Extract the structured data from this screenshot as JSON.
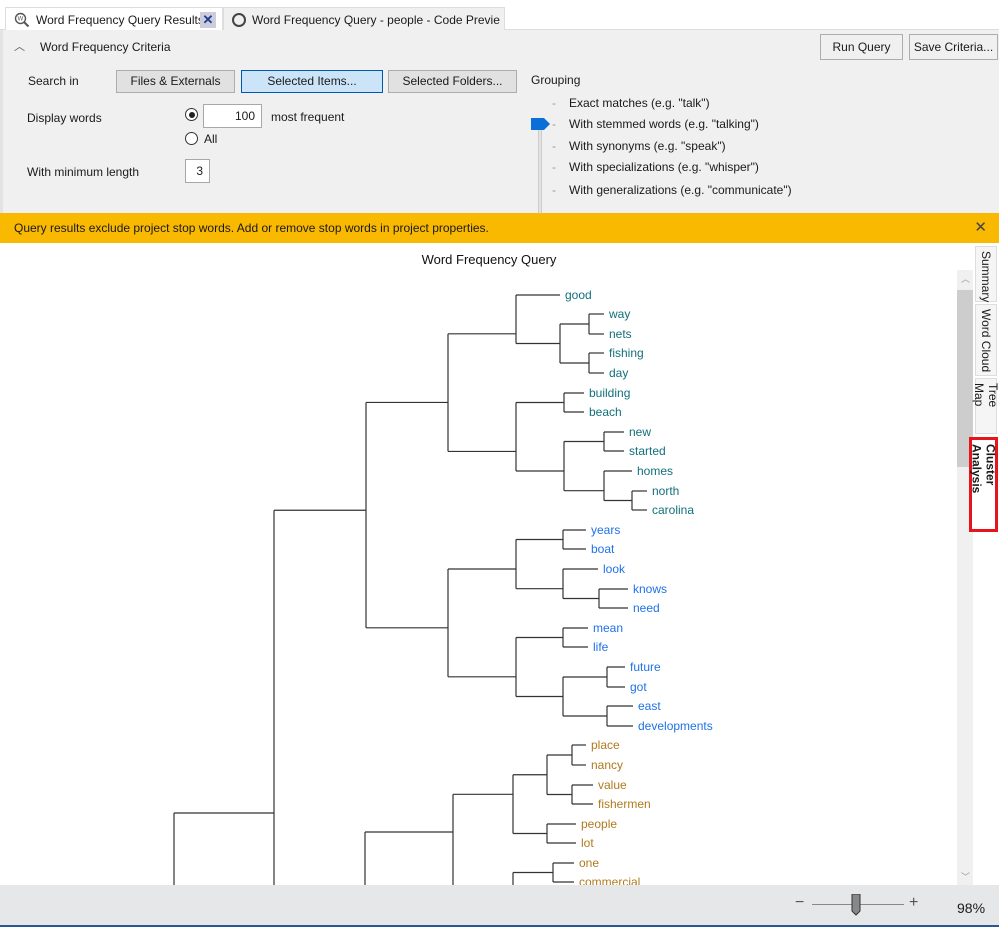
{
  "tabs": [
    {
      "label": "Word Frequency Query Results",
      "icon": "query-results-icon",
      "active": true
    },
    {
      "label": "Word Frequency Query - people - Code Previe",
      "icon": "circle-icon",
      "active": false
    }
  ],
  "criteria": {
    "title": "Word Frequency Criteria",
    "run_label": "Run Query",
    "save_label": "Save Criteria...",
    "search_in_label": "Search in",
    "search_buttons": [
      "Files & Externals",
      "Selected Items...",
      "Selected Folders..."
    ],
    "search_selected": "Selected Items...",
    "display_words_label": "Display words",
    "display_count": "100",
    "most_frequent_label": "most frequent",
    "all_label": "All",
    "display_mode": "most frequent",
    "min_length_label": "With minimum length",
    "min_length": "3",
    "grouping_label": "Grouping",
    "grouping_options": [
      "Exact matches (e.g. \"talk\")",
      "With stemmed words (e.g. \"talking\")",
      "With synonyms (e.g. \"speak\")",
      "With specializations (e.g. \"whisper\")",
      "With generalizations (e.g. \"communicate\")"
    ],
    "grouping_selected": "With stemmed words (e.g. \"talking\")"
  },
  "banner": "Query results exclude project stop words. Add or remove stop words in project properties.",
  "chart_data": {
    "type": "dendrogram",
    "title": "Word Frequency Query",
    "clusters": [
      {
        "color": "#11707a",
        "words": [
          "good",
          "way",
          "nets",
          "fishing",
          "day",
          "building",
          "beach",
          "new",
          "started",
          "homes",
          "north",
          "carolina"
        ]
      },
      {
        "color": "#1f72e8",
        "words": [
          "years",
          "boat",
          "look",
          "knows",
          "need",
          "mean",
          "life",
          "future",
          "got",
          "east",
          "developments"
        ]
      },
      {
        "color": "#b07a1c",
        "words": [
          "place",
          "nancy",
          "value",
          "fishermen",
          "people",
          "lot",
          "one",
          "commercial"
        ]
      }
    ]
  },
  "side_tabs": [
    "Summary",
    "Word Cloud",
    "Tree Map",
    "Cluster Analysis"
  ],
  "active_side_tab": "Cluster Analysis",
  "zoom": {
    "label": "98%",
    "value": 98
  }
}
